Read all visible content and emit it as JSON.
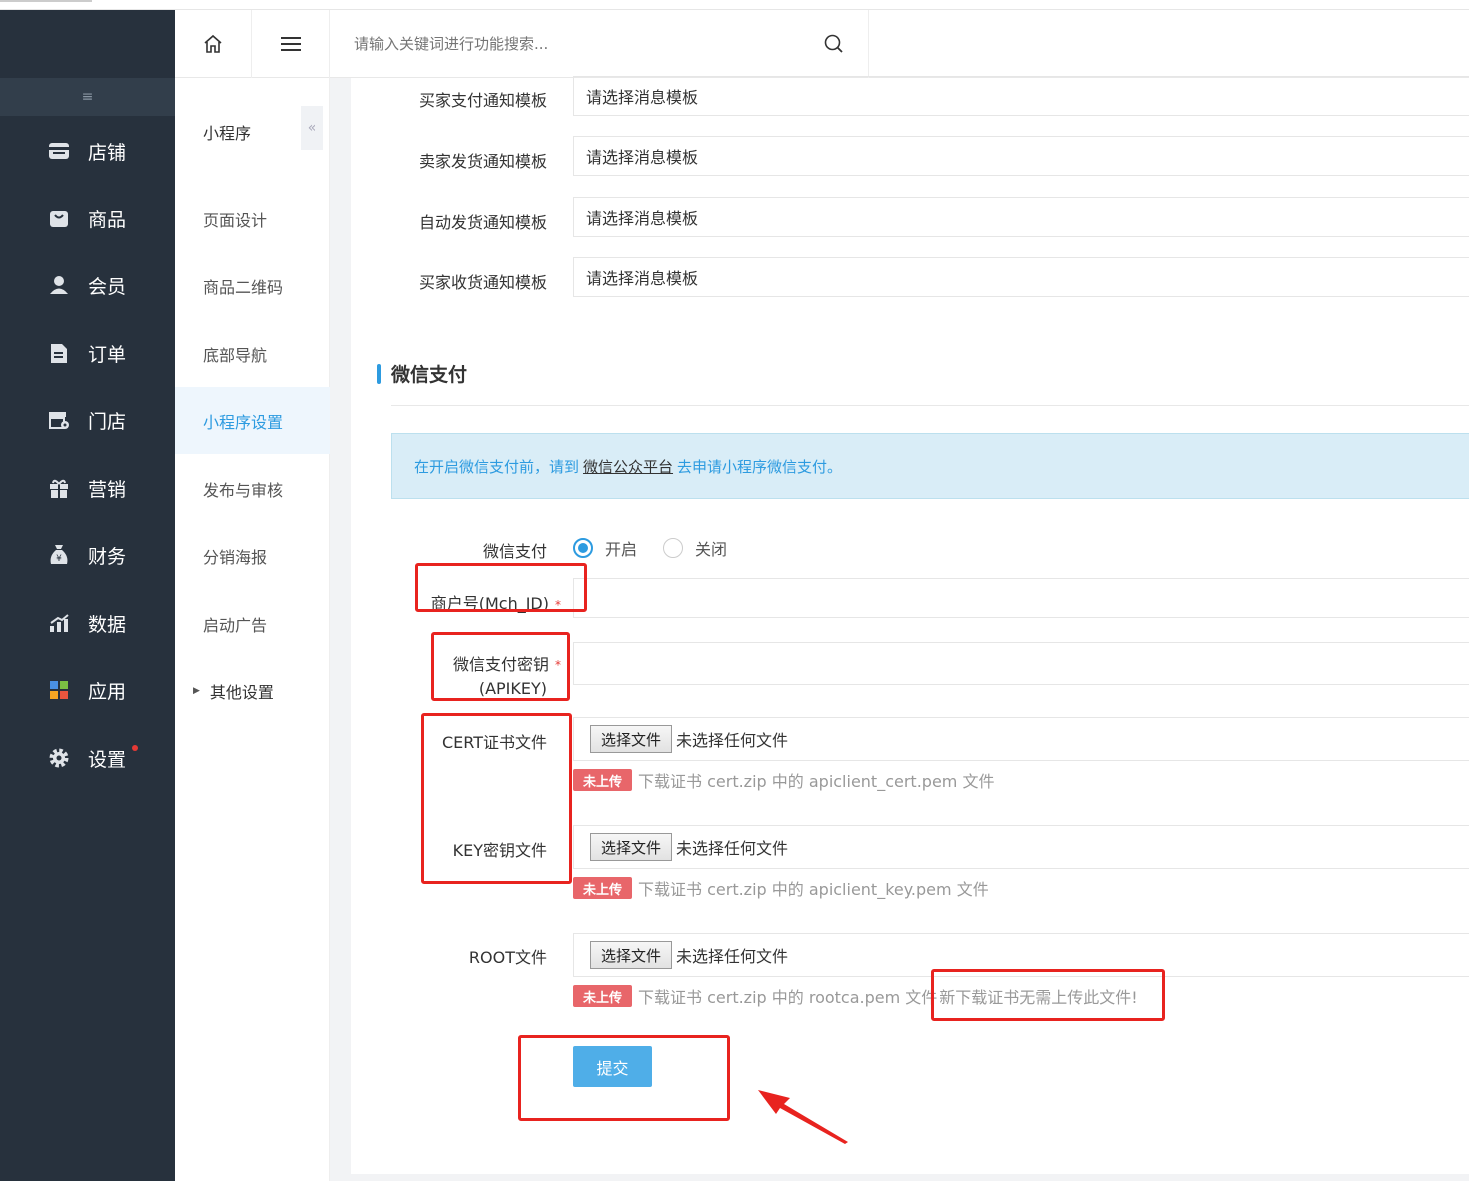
{
  "sidebar": {
    "collapse_icon": "≡",
    "items": [
      {
        "label": "店铺",
        "icon": "shop-icon"
      },
      {
        "label": "商品",
        "icon": "bag-icon"
      },
      {
        "label": "会员",
        "icon": "user-icon"
      },
      {
        "label": "订单",
        "icon": "document-icon"
      },
      {
        "label": "门店",
        "icon": "store-settings-icon"
      },
      {
        "label": "营销",
        "icon": "gift-icon"
      },
      {
        "label": "财务",
        "icon": "money-bag-icon"
      },
      {
        "label": "数据",
        "icon": "chart-icon"
      },
      {
        "label": "应用",
        "icon": "apps-icon"
      },
      {
        "label": "设置",
        "icon": "gear-icon"
      }
    ]
  },
  "header": {
    "search_placeholder": "请输入关键词进行功能搜索..."
  },
  "subnav": {
    "title": "小程序",
    "fold_icon": "«",
    "items": [
      {
        "label": "页面设计"
      },
      {
        "label": "商品二维码"
      },
      {
        "label": "底部导航"
      },
      {
        "label": "小程序设置"
      },
      {
        "label": "发布与审核"
      },
      {
        "label": "分销海报"
      },
      {
        "label": "启动广告"
      },
      {
        "label": "其他设置"
      }
    ]
  },
  "templates": [
    {
      "label": "买家支付通知模板",
      "value": "请选择消息模板"
    },
    {
      "label": "卖家发货通知模板",
      "value": "请选择消息模板"
    },
    {
      "label": "自动发货通知模板",
      "value": "请选择消息模板"
    },
    {
      "label": "买家收货通知模板",
      "value": "请选择消息模板"
    }
  ],
  "wechat_pay": {
    "section_title": "微信支付",
    "alert_prefix": "在开启微信支付前，请到",
    "alert_link": "微信公众平台",
    "alert_suffix": "去申请小程序微信支付。",
    "toggle_label": "微信支付",
    "on_label": "开启",
    "off_label": "关闭",
    "mch_label": "商户号(Mch_ID)",
    "key_label_1": "微信支付密钥",
    "key_label_2": "(APIKEY)",
    "required_mark": "*",
    "files": [
      {
        "label": "CERT证书文件",
        "button": "选择文件",
        "status": "未选择任何文件",
        "tag": "未上传",
        "hint": "下载证书 cert.zip 中的 apiclient_cert.pem 文件"
      },
      {
        "label": "KEY密钥文件",
        "button": "选择文件",
        "status": "未选择任何文件",
        "tag": "未上传",
        "hint": "下载证书 cert.zip 中的 apiclient_key.pem 文件"
      },
      {
        "label": "ROOT文件",
        "button": "选择文件",
        "status": "未选择任何文件",
        "tag": "未上传",
        "hint": "下载证书 cert.zip 中的 rootca.pem 文件",
        "extra": "新下载证书无需上传此文件!"
      }
    ],
    "submit_label": "提交"
  },
  "colors": {
    "sidebar_bg": "#27313d",
    "accent": "#2d9be0",
    "annotation": "#e8231f",
    "tag_bg": "#e8666a"
  }
}
